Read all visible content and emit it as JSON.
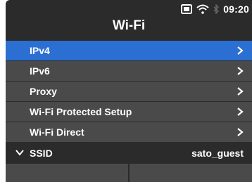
{
  "status": {
    "time": "09:20"
  },
  "header": {
    "title": "Wi-Fi"
  },
  "menu": {
    "items": [
      {
        "label": "IPv4",
        "selected": true
      },
      {
        "label": "IPv6",
        "selected": false
      },
      {
        "label": "Proxy",
        "selected": false
      },
      {
        "label": "Wi-Fi Protected Setup",
        "selected": false
      },
      {
        "label": "Wi-Fi Direct",
        "selected": false
      }
    ]
  },
  "ssid": {
    "label": "SSID",
    "value": "sato_guest"
  },
  "colors": {
    "selected": "#2b6fd2",
    "row": "#4a4a4a",
    "background": "#2b2b2b"
  },
  "icons": [
    "sd-card-icon",
    "wifi-icon",
    "bluetooth-icon",
    "chevron-right-icon",
    "chevron-down-icon"
  ]
}
